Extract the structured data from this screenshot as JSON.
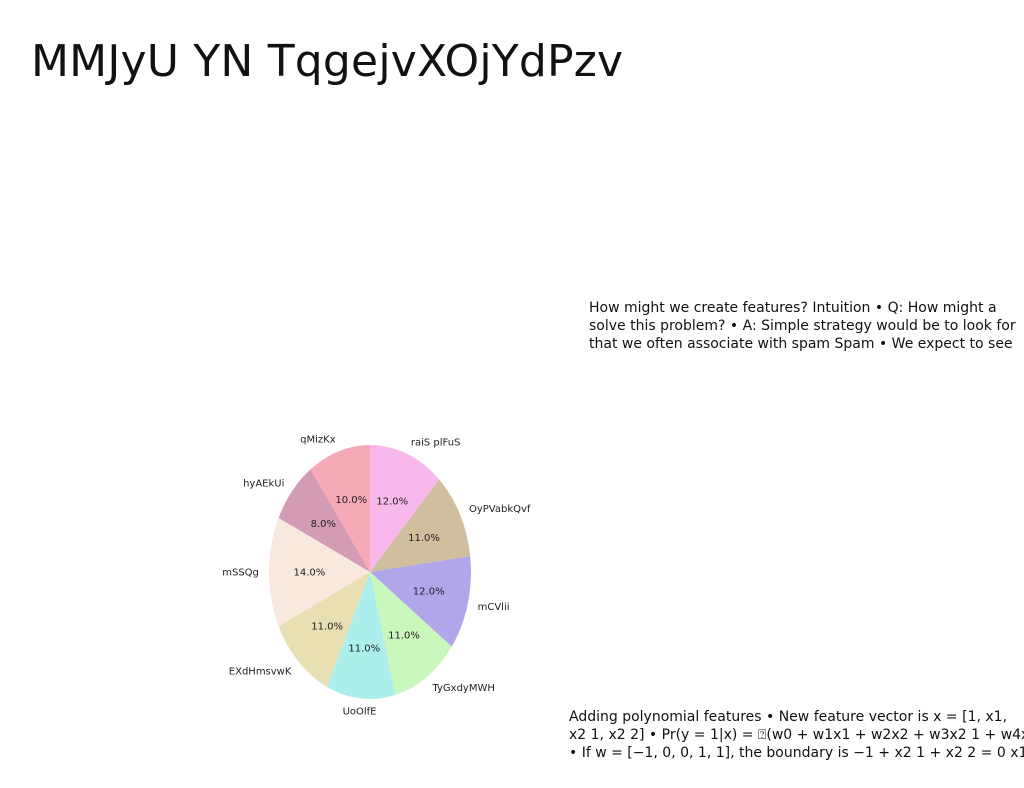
{
  "slide": {
    "title": "MMJyU YN TqgejvXOjYdPzv"
  },
  "text_top": {
    "lines": [
      "How might we create features? Intuition • Q: How might a",
      "solve this problem? • A: Simple strategy would be to look for",
      "that we often associate with spam Spam • We expect to see"
    ]
  },
  "text_bottom": {
    "lines": [
      "Adding polynomial features • New feature vector is x = [1, x1,",
      "x2 1, x2 2] • Pr(y = 1|x) = ⍰(w0 + w1x1 + w2x2 + w3x2 1 + w4x2",
      "• If w = [−1, 0, 0, 1, 1], the boundary is −1 + x2 1 + x2 2 = 0 x1"
    ]
  },
  "chart_data": {
    "type": "pie",
    "title": "",
    "start_angle_deg": 90,
    "direction": "clockwise",
    "slices": [
      {
        "label": "raiS plFuS",
        "value": 12.0,
        "pct_label": "12.0%",
        "color": "#f9b8ec"
      },
      {
        "label": "OyPVabkQvf",
        "value": 11.0,
        "pct_label": "11.0%",
        "color": "#d0be9e"
      },
      {
        "label": "mCVlii",
        "value": 12.0,
        "pct_label": "12.0%",
        "color": "#b1a6ea"
      },
      {
        "label": "TyGxdyMWH",
        "value": 11.0,
        "pct_label": "11.0%",
        "color": "#caf7bb"
      },
      {
        "label": "UoOlfE",
        "value": 11.0,
        "pct_label": "11.0%",
        "color": "#abeeec"
      },
      {
        "label": "EXdHmsvwK",
        "value": 11.0,
        "pct_label": "11.0%",
        "color": "#e8dfb2"
      },
      {
        "label": "mSSQg",
        "value": 14.0,
        "pct_label": "14.0%",
        "color": "#f8e8dd"
      },
      {
        "label": "hyAEkUi",
        "value": 8.0,
        "pct_label": "8.0%",
        "color": "#d49cb4"
      },
      {
        "label": "qMizKx",
        "value": 10.0,
        "pct_label": "10.0%",
        "color": "#f6a9b6"
      }
    ]
  }
}
